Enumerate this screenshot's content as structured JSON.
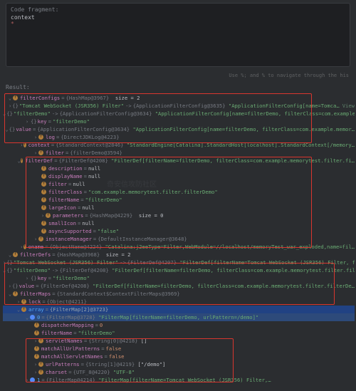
{
  "code_fragment": {
    "label": "Code fragment:",
    "input": "context",
    "caret": "*"
  },
  "hint": "Use %; and %  to navigate through the his",
  "result_label": "Result:",
  "tree": {
    "filterConfigs": {
      "name": "filterConfigs",
      "type": "{HashMap@3967}",
      "size_label": "size = 2",
      "e0": {
        "key_name": "\"Tomcat WebSocket (JSR356) Filter\"",
        "val_type": "{ApplicationFilterConfig@3635}",
        "val_str": "\"ApplicationFilterConfig[name=Tomca…"
      },
      "e1": {
        "key_name": "\"filterDemo\"",
        "val_type": "{ApplicationFilterConfig@3634}",
        "val_str": "\"ApplicationFilterConfig[name=filterDemo, filterClass=com.example…",
        "key_field": {
          "name": "key",
          "value": "\"filterDemo\""
        },
        "value_field": {
          "name": "value",
          "type": "{ApplicationFilterConfig@3634}",
          "str": "\"ApplicationFilterConfig[name=filterDemo, filterClass=com.example.memor…",
          "log": {
            "name": "log",
            "type": "{DirectJDKLog@4223}"
          },
          "context": {
            "name": "context",
            "type": "{StandardContext@2846}",
            "str": "\"StandardEngine[Catalina].StandardHost[localhost].StandardContext[/memory…"
          },
          "filter": {
            "name": "filter",
            "type": "{filterDemo@3594}"
          },
          "filterDef": {
            "name": "filterDef",
            "type": "{FilterDef@4208}",
            "str": "\"FilterDef[filterName=filterDemo, filterClass=com.example.memorytest.filter.fi…",
            "description": {
              "name": "description",
              "value": "null"
            },
            "displayName": {
              "name": "displayName",
              "value": "null"
            },
            "filter_inner": {
              "name": "filter",
              "value": "null"
            },
            "filterClass": {
              "name": "filterClass",
              "value": "\"com.example.memorytest.filter.filterDemo\""
            },
            "filterName": {
              "name": "filterName",
              "value": "\"filterDemo\""
            },
            "largeIcon": {
              "name": "largeIcon",
              "value": "null"
            },
            "parameters": {
              "name": "parameters",
              "type": "{HashMap@4229}",
              "size_label": "size = 0"
            },
            "smallIcon": {
              "name": "smallIcon",
              "value": "null"
            },
            "asyncSupported": {
              "name": "asyncSupported",
              "value": "\"false\""
            }
          },
          "instanceManager": {
            "name": "instanceManager",
            "type": "{DefaultInstanceManager@3648}"
          },
          "oname": {
            "name": "oname",
            "type": "{ObjectName@4224}",
            "str": "\"Catalina:j2eeType=Filter,WebModule=//localhost/memoryTest_war_exploded,name=fil…"
          }
        }
      }
    },
    "filterDefs": {
      "name": "filterDefs",
      "type": "{HashMap@3968}",
      "size_label": "size = 2",
      "e0": {
        "key_name": "\"Tomcat WebSocket (JSR356) Filter\"",
        "val_type": "{FilterDef@4207}",
        "val_str": "\"FilterDef[filterName=Tomcat WebSocket (JSR356) Filter, f…"
      },
      "e1": {
        "key_name": "\"filterDemo\"",
        "val_type": "{FilterDef@4208}",
        "val_str": "\"FilterDef[filterName=filterDemo, filterClass=com.example.memorytest.filter.filterDe…",
        "key_field": {
          "name": "key",
          "value": "\"filterDemo\""
        },
        "value_field": {
          "name": "value",
          "type": "{FilterDef@4208}",
          "str": "\"FilterDef[filterName=filterDemo, filterClass=com.example.memorytest.filter.filterDe…"
        }
      }
    },
    "filterMaps": {
      "name": "filterMaps",
      "type": "{StandardContext$ContextFilterMaps@3969}",
      "lock": {
        "name": "lock",
        "type": "{Object@4211}"
      },
      "array": {
        "name": "array",
        "type": "{FilterMap[2]@3723}",
        "e0": {
          "idx": "0",
          "type": "{FilterMap@3728}",
          "str": "\"FilterMap[filterName=filterDemo, urlPattern=/demo]\"",
          "dispatcherMapping": {
            "name": "dispatcherMapping",
            "value": "0"
          },
          "filterName": {
            "name": "filterName",
            "value": "\"filterDemo\""
          },
          "servletNames": {
            "name": "servletNames",
            "type": "{String[0]@4218}",
            "value": "[]"
          },
          "matchAllUrlPatterns": {
            "name": "matchAllUrlPatterns",
            "value": "false"
          },
          "matchAllServletNames": {
            "name": "matchAllServletNames",
            "value": "false"
          },
          "urlPatterns": {
            "name": "urlPatterns",
            "type": "{String[1]@4219}",
            "value": "[\"/demo\"]"
          },
          "charset": {
            "name": "charset",
            "type": "{UTF_8@4220}",
            "str": "\"UTF-8\""
          }
        },
        "e1": {
          "idx": "1",
          "type": "{FilterMap@4214}",
          "str": "\"FilterMap[filterName=Tomcat WebSocket (JSR356) Filter,…"
        }
      }
    }
  },
  "view": "View"
}
